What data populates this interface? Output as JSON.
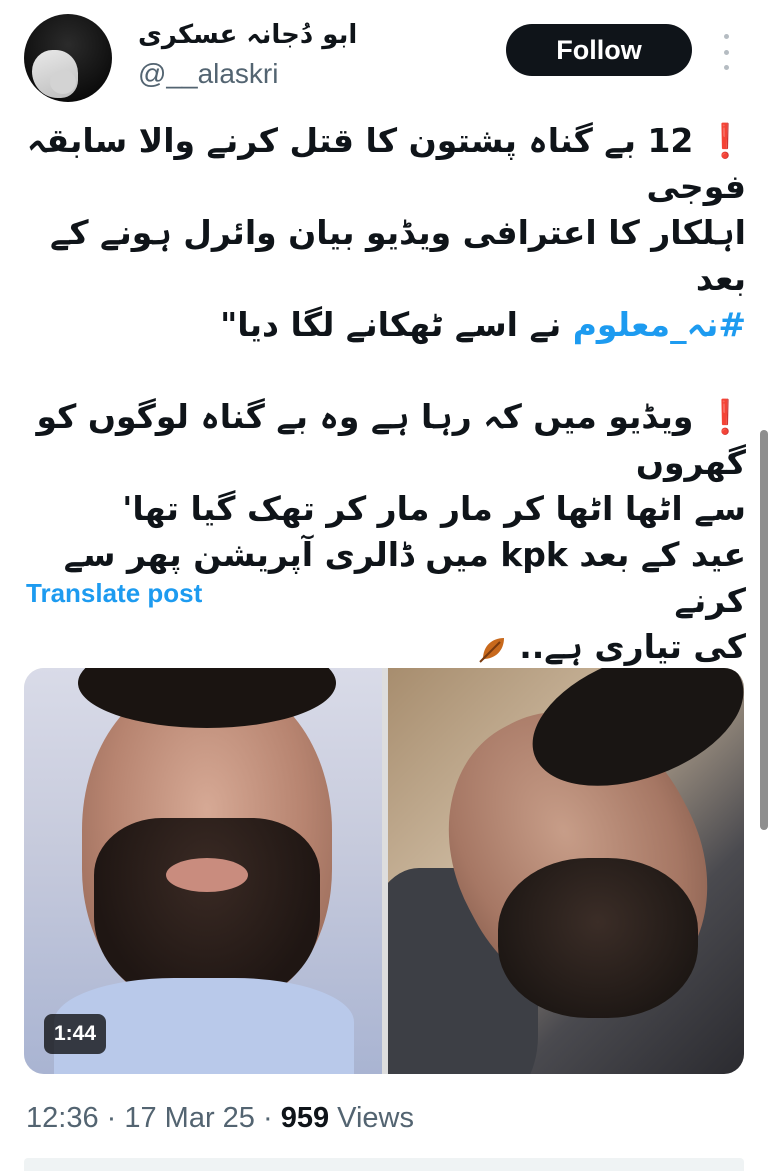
{
  "author": {
    "display_name": "ابو دُجانہ عسکری",
    "handle": "@__alaskri",
    "avatar_icon": "avatar-image"
  },
  "actions": {
    "follow_label": "Follow",
    "more_icon": "more-options-icon"
  },
  "tweet": {
    "exclamation": "❗",
    "p1_line1": "12 بے گناہ پشتون کا قتل کرنے والا سابقہ فوجی",
    "p1_line2": "اہلکار کا اعترافی ویڈیو بیان وائرل ہونے کے بعد",
    "hashtag": "#نہ_معلوم",
    "p1_line3_rest": " نے اسے ٹھکانے لگا دیا\"",
    "p2_line1": "ویڈیو میں کہ رہا ہے وہ بے گناہ لوگوں کو گھروں",
    "p2_line2": "سے اٹھا اٹھا کر مار مار کر تھک گیا تھا'",
    "p3_line1": "عید کے بعد kpk میں ڈالری آپریشن پھر سے کرنے",
    "p3_line2": "کی تیاری ہے..",
    "emoji_icon": "fallen-leaf-icon"
  },
  "translate_label": "Translate post",
  "media": {
    "duration": "1:44",
    "left_image": "video-thumbnail-man",
    "right_image": "photo-man-lying"
  },
  "meta": {
    "time": "12:36",
    "sep1": " · ",
    "date": "17 Mar 25",
    "sep2": " · ",
    "views_count": "959",
    "views_label": " Views"
  },
  "colors": {
    "link": "#1d9bf0",
    "text": "#0f1419",
    "secondary": "#536471",
    "alert": "#f4212e"
  }
}
